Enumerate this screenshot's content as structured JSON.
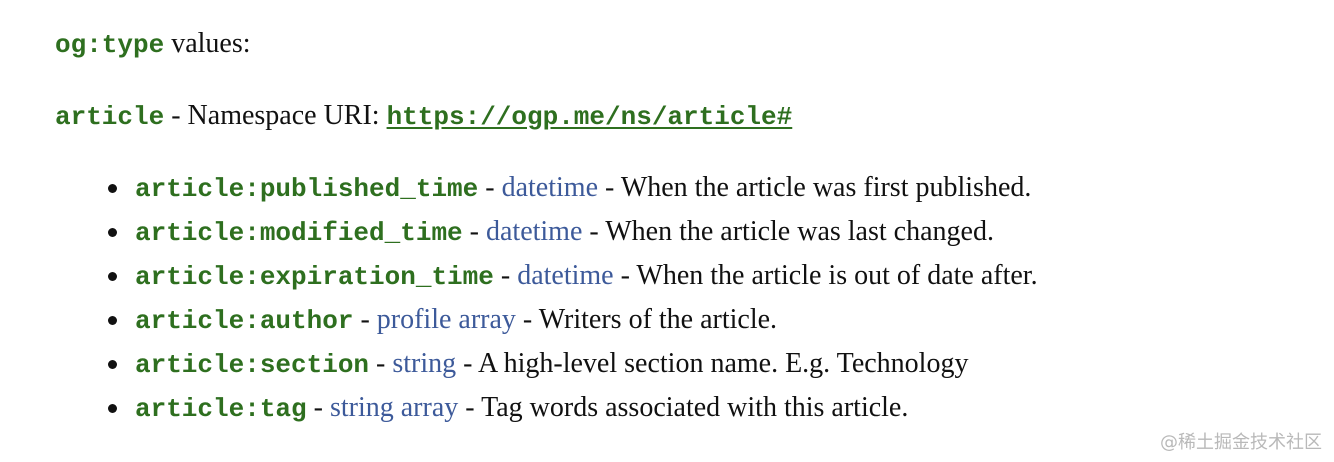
{
  "heading": {
    "code": "og:type",
    "text": " values:"
  },
  "namespace": {
    "code": "article",
    "separator": " - Namespace URI: ",
    "uri": "https://ogp.me/ns/article#"
  },
  "properties": [
    {
      "name": "article:published_time",
      "type": "datetime",
      "description": "When the article was first published."
    },
    {
      "name": "article:modified_time",
      "type": "datetime",
      "description": "When the article was last changed."
    },
    {
      "name": "article:expiration_time",
      "type": "datetime",
      "description": "When the article is out of date after."
    },
    {
      "name": "article:author",
      "type": "profile array",
      "description": "Writers of the article."
    },
    {
      "name": "article:section",
      "type": "string",
      "description": "A high-level section name. E.g. Technology"
    },
    {
      "name": "article:tag",
      "type": "string array",
      "description": "Tag words associated with this article."
    }
  ],
  "watermark": "@稀土掘金技术社区"
}
